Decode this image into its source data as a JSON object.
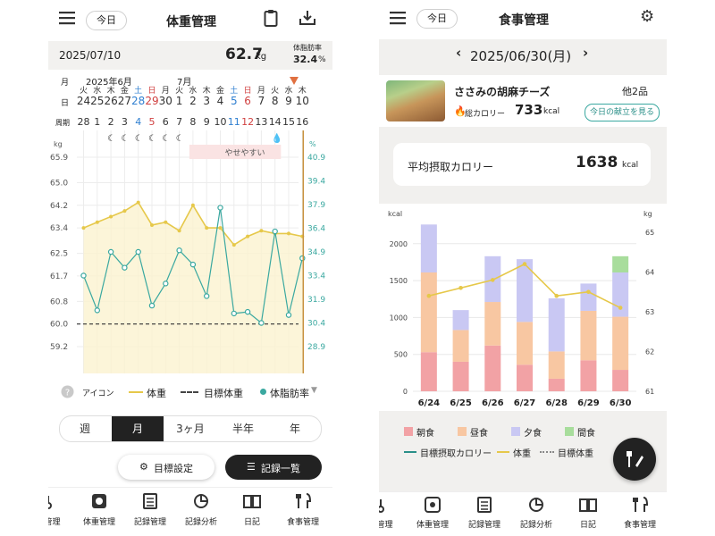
{
  "left": {
    "header": {
      "today": "今日",
      "title": "体重管理"
    },
    "summary": {
      "date": "2025/07/10",
      "weight": "62.7",
      "weight_unit": "kg",
      "bodyfat_label": "体脂肪率",
      "bodyfat": "32.4",
      "bodyfat_unit": "%"
    },
    "calendar": {
      "month_row_label": "月",
      "day_row_label": "日",
      "week_row_label": "周期",
      "month_june": "2025年6月",
      "month_july": "7月",
      "weekdays": [
        "火",
        "水",
        "木",
        "金",
        "土",
        "日",
        "月",
        "火",
        "水",
        "木",
        "金",
        "土",
        "日",
        "月",
        "火",
        "水",
        "木"
      ],
      "days": [
        "24",
        "25",
        "26",
        "27",
        "28",
        "29",
        "30",
        "1",
        "2",
        "3",
        "4",
        "5",
        "6",
        "7",
        "8",
        "9",
        "10"
      ],
      "cycle": [
        "28",
        "1",
        "2",
        "3",
        "4",
        "5",
        "6",
        "7",
        "8",
        "9",
        "10",
        "11",
        "12",
        "13",
        "14",
        "15",
        "16"
      ]
    },
    "chart": {
      "left_unit": "kg",
      "right_unit": "%",
      "left_ticks": [
        "65.9",
        "65.0",
        "64.2",
        "63.4",
        "62.5",
        "61.7",
        "60.8",
        "60.0",
        "59.2"
      ],
      "right_ticks": [
        "40.9",
        "39.4",
        "37.9",
        "36.4",
        "34.9",
        "33.4",
        "31.9",
        "30.4",
        "28.9"
      ],
      "band_label": "やせやすい"
    },
    "chart_data": {
      "type": "line",
      "x": [
        "6/24",
        "6/25",
        "6/26",
        "6/27",
        "6/28",
        "6/29",
        "6/30",
        "7/1",
        "7/2",
        "7/3",
        "7/4",
        "7/5",
        "7/6",
        "7/7",
        "7/8",
        "7/9",
        "7/10"
      ],
      "series": [
        {
          "name": "体重",
          "color": "#e6c84a",
          "values": [
            63.4,
            63.6,
            63.8,
            64.0,
            64.3,
            63.5,
            63.6,
            63.3,
            64.2,
            63.4,
            63.4,
            62.8,
            63.1,
            63.3,
            63.2,
            63.2,
            63.1
          ]
        },
        {
          "name": "体脂肪率",
          "color": "#3aa8a0",
          "values": [
            33.4,
            31.2,
            34.9,
            33.9,
            34.9,
            31.5,
            32.9,
            35.0,
            34.1,
            32.1,
            37.7,
            31.0,
            31.1,
            30.4,
            36.2,
            30.9,
            34.5
          ]
        }
      ],
      "target": {
        "name": "目標体重",
        "value": 60.0
      },
      "ylim": [
        59.2,
        65.9
      ],
      "y2lim": [
        28.9,
        40.9
      ]
    },
    "legend": {
      "icon": "アイコン",
      "weight": "体重",
      "target": "目標体重",
      "bodyfat": "体脂肪率"
    },
    "periods": [
      "週",
      "月",
      "3ヶ月",
      "半年",
      "年"
    ],
    "actions": {
      "goal": "目標設定",
      "records": "記録一覧"
    },
    "nav": [
      "温管理",
      "体重管理",
      "記録管理",
      "記録分析",
      "日記",
      "食事管理"
    ]
  },
  "right": {
    "header": {
      "today": "今日",
      "title": "食事管理"
    },
    "date": "2025/06/30(月)",
    "meal": {
      "name": "ささみの胡麻チーズ",
      "extra": "他2品",
      "cal_label": "総カロリー",
      "cal_value": "733",
      "cal_unit": "kcal",
      "menu_button": "今日の献立を見る"
    },
    "avg": {
      "label": "平均摂取カロリー",
      "value": "1638",
      "unit": "kcal"
    },
    "chart": {
      "left_unit": "kcal",
      "right_unit": "kg",
      "left_ticks": [
        "2000",
        "1500",
        "1000",
        "500",
        "0"
      ],
      "right_ticks": [
        "65",
        "64",
        "63",
        "62",
        "61"
      ]
    },
    "chart_data": {
      "type": "bar",
      "categories": [
        "6/24",
        "6/25",
        "6/26",
        "6/27",
        "6/28",
        "6/29",
        "6/30"
      ],
      "series": [
        {
          "name": "朝食",
          "color": "#f2a2a5",
          "values": [
            530,
            400,
            620,
            360,
            170,
            420,
            290
          ]
        },
        {
          "name": "昼食",
          "color": "#f8c7a2",
          "values": [
            1080,
            430,
            590,
            580,
            370,
            670,
            720
          ]
        },
        {
          "name": "夕食",
          "color": "#c9c8f3",
          "values": [
            650,
            270,
            620,
            850,
            720,
            370,
            600
          ]
        },
        {
          "name": "間食",
          "color": "#a8dd9c",
          "values": [
            0,
            0,
            0,
            0,
            0,
            0,
            220
          ]
        }
      ],
      "weight": {
        "name": "体重",
        "color": "#e6c84a",
        "values": [
          63.4,
          63.6,
          63.8,
          64.2,
          63.4,
          63.5,
          63.1
        ]
      },
      "target_calorie": {
        "name": "目標摂取カロリー"
      },
      "target_weight": {
        "name": "目標体重"
      },
      "ylim": [
        0,
        2300
      ],
      "y2lim": [
        61,
        65
      ]
    },
    "legend": {
      "breakfast": "朝食",
      "lunch": "昼食",
      "dinner": "夕食",
      "snack": "間食",
      "target_cal": "目標摂取カロリー",
      "weight": "体重",
      "target_weight": "目標体重"
    },
    "nav": [
      "温管理",
      "体重管理",
      "記録管理",
      "記録分析",
      "日記",
      "食事管理"
    ]
  }
}
